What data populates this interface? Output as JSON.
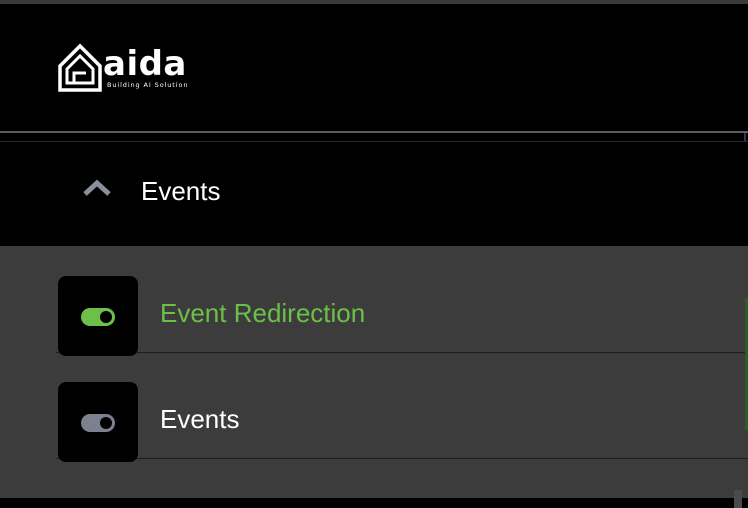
{
  "brand": {
    "name": "aida",
    "tagline": "Building AI Solution"
  },
  "section": {
    "title": "Events",
    "expanded": true
  },
  "menu": {
    "items": [
      {
        "label": "Event Redirection",
        "active": true,
        "icon": "toggle-on-icon"
      },
      {
        "label": "Events",
        "active": false,
        "icon": "toggle-off-icon"
      }
    ]
  },
  "colors": {
    "accent": "#6cc04a",
    "panel": "#3c3c3c",
    "background": "#000000",
    "inactive_icon": "#7c8190"
  }
}
